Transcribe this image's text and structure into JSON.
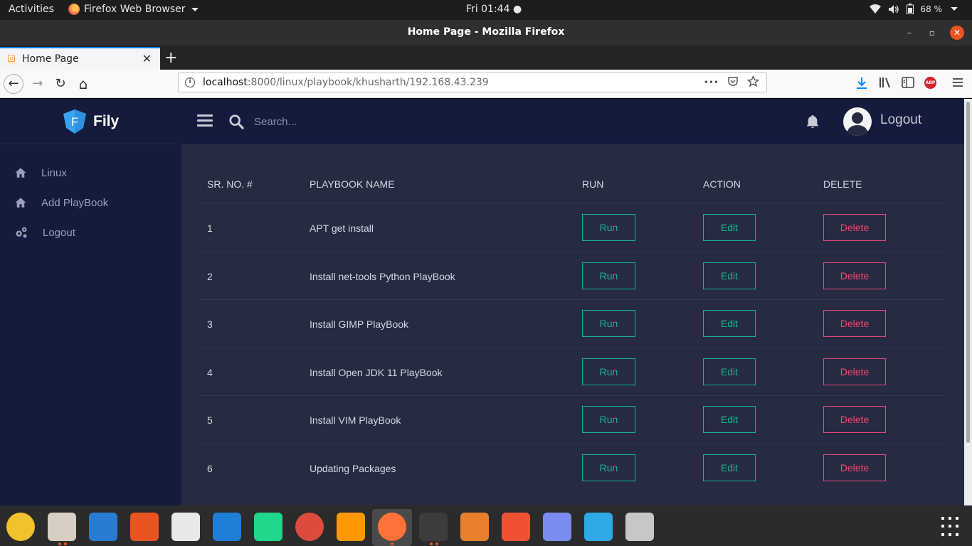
{
  "topbar": {
    "activities": "Activities",
    "app_name": "Firefox Web Browser",
    "clock": "Fri 01:44",
    "battery": "68 %"
  },
  "window": {
    "title": "Home Page - Mozilla Firefox",
    "minimize": "–",
    "maximize": "▫",
    "close": "✕"
  },
  "tab": {
    "favicon": "u",
    "label": "Home Page",
    "close": "✕",
    "new_tab": "+"
  },
  "navbar": {
    "back": "←",
    "forward": "→",
    "reload": "↻",
    "home": "⌂",
    "url_host": "localhost",
    "url_rest": ":8000/linux/playbook/khusharth/192.168.43.239",
    "more": "•••",
    "abp": "ABP"
  },
  "app": {
    "brand_letter": "F",
    "brand_name": "Fily",
    "sidebar": [
      {
        "label": "Linux",
        "icon": "home-icon"
      },
      {
        "label": "Add PlayBook",
        "icon": "home-icon"
      },
      {
        "label": "Logout",
        "icon": "cogs-icon"
      }
    ],
    "search_placeholder": "Search...",
    "logout": "Logout"
  },
  "table": {
    "headers": {
      "sr": "SR. NO. #",
      "name": "PLAYBOOK NAME",
      "run": "RUN",
      "action": "ACTION",
      "delete": "DELETE"
    },
    "rows": [
      {
        "sr": "1",
        "name": "APT get install",
        "run": "Run",
        "edit": "Edit",
        "delete": "Delete"
      },
      {
        "sr": "2",
        "name": "Install net-tools Python PlayBook",
        "run": "Run",
        "edit": "Edit",
        "delete": "Delete"
      },
      {
        "sr": "3",
        "name": "Install GIMP PlayBook",
        "run": "Run",
        "edit": "Edit",
        "delete": "Delete"
      },
      {
        "sr": "4",
        "name": "Install Open JDK 11 PlayBook",
        "run": "Run",
        "edit": "Edit",
        "delete": "Delete"
      },
      {
        "sr": "5",
        "name": "Install VIM PlayBook",
        "run": "Run",
        "edit": "Edit",
        "delete": "Delete"
      },
      {
        "sr": "6",
        "name": "Updating Packages",
        "run": "Run",
        "edit": "Edit",
        "delete": "Delete"
      }
    ]
  },
  "colors": {
    "content_bg": "#262b41",
    "sidebar_bg": "#141b3d",
    "run_edit": "#1bb394",
    "delete": "#ea4a72",
    "ubuntu_orange": "#e95420"
  },
  "dock": [
    {
      "name": "rhythmbox-icon",
      "color": "#f2c22e"
    },
    {
      "name": "files-icon",
      "color": "#d6cfc3"
    },
    {
      "name": "libreoffice-writer-icon",
      "color": "#2a7bd4"
    },
    {
      "name": "software-center-icon",
      "color": "#e95420"
    },
    {
      "name": "image-viewer-icon",
      "color": "#e8e8e8"
    },
    {
      "name": "system-monitor-icon",
      "color": "#1f7fd6"
    },
    {
      "name": "pycharm-icon",
      "color": "#21d789"
    },
    {
      "name": "chrome-icon",
      "color": "#dd4b3e"
    },
    {
      "name": "sublime-text-icon",
      "color": "#ff9800"
    },
    {
      "name": "firefox-icon",
      "color": "#ff7139"
    },
    {
      "name": "terminal-icon",
      "color": "#3c3c3c"
    },
    {
      "name": "libreoffice-impress-icon",
      "color": "#e8802b"
    },
    {
      "name": "git-icon",
      "color": "#f05133"
    },
    {
      "name": "screenshot-icon",
      "color": "#7b8cf0"
    },
    {
      "name": "remmina-icon",
      "color": "#2ea8e6"
    },
    {
      "name": "installer-icon",
      "color": "#c7c7c7"
    }
  ]
}
